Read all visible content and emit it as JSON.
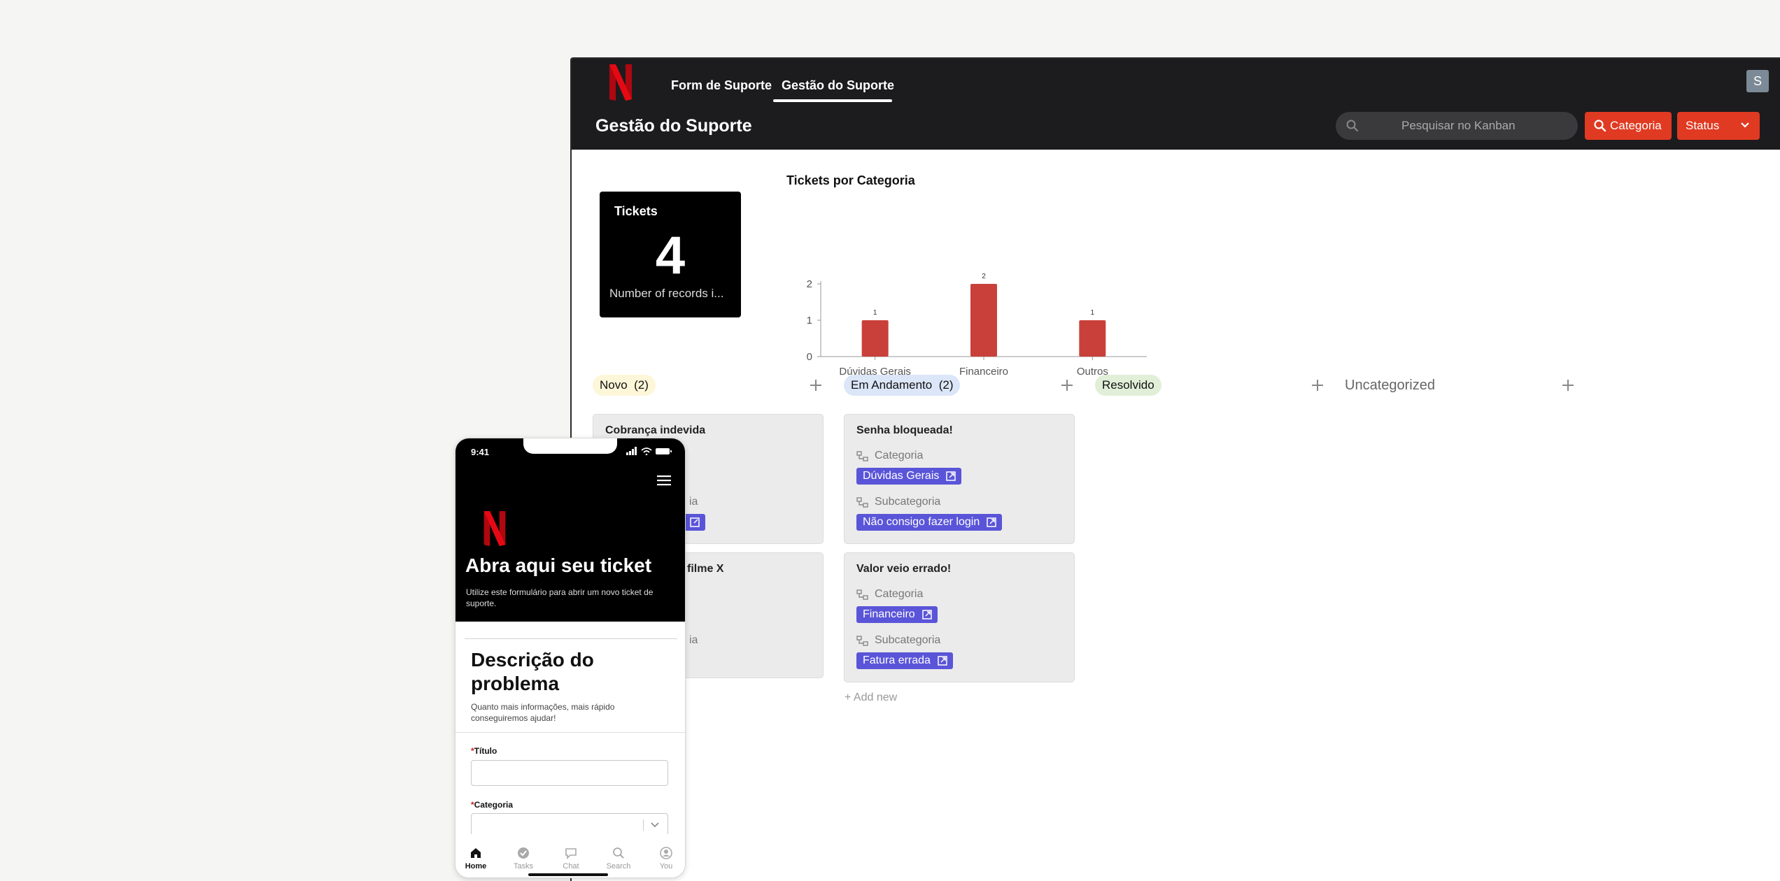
{
  "nav": {
    "tabs": [
      {
        "label": "Form de Suporte",
        "active": false
      },
      {
        "label": "Gestão do Suporte",
        "active": true
      }
    ],
    "avatar_initial": "S"
  },
  "header": {
    "title": "Gestão do Suporte",
    "search_placeholder": "Pesquisar no Kanban",
    "category_button": "Categoria",
    "status_button": "Status"
  },
  "kpi": {
    "title": "Tickets",
    "value": "4",
    "subtitle": "Number of records i..."
  },
  "chart_data": {
    "type": "bar",
    "title": "Tickets por Categoria",
    "categories": [
      "Dúvidas Gerais",
      "Financeiro",
      "Outros"
    ],
    "values": [
      1,
      2,
      1
    ],
    "ylim": [
      0,
      2
    ],
    "yticks": [
      "0",
      "1",
      "2"
    ],
    "bar_color": "#c9403a",
    "grid": false
  },
  "kanban": {
    "columns": [
      {
        "label": "Novo",
        "count": "(2)",
        "color": "#fdf6d8"
      },
      {
        "label": "Em Andamento",
        "count": "(2)",
        "color": "#dbe6f8"
      },
      {
        "label": "Resolvido",
        "count": "",
        "color": "#e1efd9"
      },
      {
        "label": "Uncategorized",
        "count": "",
        "color": ""
      }
    ],
    "field_category": "Categoria",
    "field_subcategory": "Subcategoria",
    "cards": {
      "novo_1": {
        "title": "Cobrança indevida"
      },
      "novo_2": {
        "title": "filme X"
      },
      "and_1": {
        "title": "Senha bloqueada!",
        "category": "Dúvidas Gerais",
        "subcategory": "Não consigo fazer login"
      },
      "and_2": {
        "title": "Valor veio errado!",
        "category": "Financeiro",
        "subcategory": "Fatura errada"
      }
    },
    "add_new": "Add new",
    "tag_color": "#5a55d8"
  },
  "mobile": {
    "time": "9:41",
    "hero_title": "Abra aqui seu ticket",
    "hero_subtitle": "Utilize este formulário para abrir um novo ticket de suporte.",
    "section_title": "Descrição do problema",
    "section_subtitle": "Quanto mais informações, mais rápido conseguiremos ajudar!",
    "field_title": "Título",
    "field_category": "Categoria",
    "required_mark": "*",
    "bottom_nav": [
      {
        "label": "Home",
        "icon": "home-icon",
        "active": true
      },
      {
        "label": "Tasks",
        "icon": "check-circle-icon",
        "active": false
      },
      {
        "label": "Chat",
        "icon": "chat-icon",
        "active": false
      },
      {
        "label": "Search",
        "icon": "search-icon",
        "active": false
      },
      {
        "label": "You",
        "icon": "user-icon",
        "active": false
      }
    ]
  },
  "colors": {
    "brand_red": "#e50914",
    "button_red": "#e03a22",
    "topbar": "#1c1c1e"
  }
}
